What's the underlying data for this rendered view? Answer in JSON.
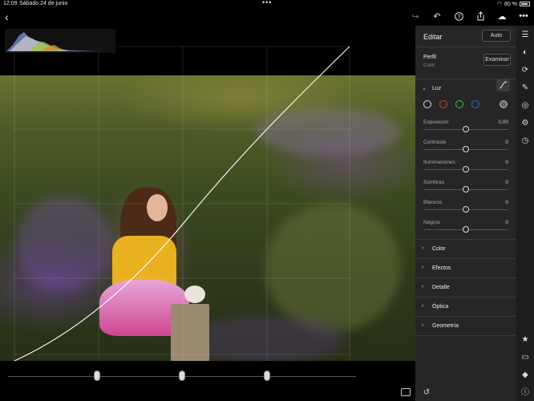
{
  "status": {
    "time": "12:09",
    "date": "Sábado 24 de junio",
    "battery": "80 %"
  },
  "toolbar": {
    "icons": [
      "share-back-icon",
      "undo-icon",
      "help-icon",
      "export-icon",
      "cloud-sync-icon",
      "more-icon"
    ]
  },
  "panel": {
    "title": "Editar",
    "auto_label": "Auto",
    "profile": {
      "label": "Perfil",
      "value": "Color",
      "browse_label": "Examinar"
    },
    "luz": {
      "label": "Luz",
      "channels": [
        {
          "name": "white-channel-icon",
          "color": "#dddddd"
        },
        {
          "name": "red-channel-icon",
          "color": "#e03a3a"
        },
        {
          "name": "green-channel-icon",
          "color": "#4cbf4c"
        },
        {
          "name": "blue-channel-icon",
          "color": "#3a62d6"
        }
      ],
      "sliders": [
        {
          "label": "Exposición",
          "value": "0,00"
        },
        {
          "label": "Contraste",
          "value": "0"
        },
        {
          "label": "Iluminaciones",
          "value": "0"
        },
        {
          "label": "Sombras",
          "value": "0"
        },
        {
          "label": "Blancos",
          "value": "0"
        },
        {
          "label": "Negros",
          "value": "0"
        }
      ]
    },
    "sections": [
      "Color",
      "Efectos",
      "Detalle",
      "Óptica",
      "Geometría"
    ]
  },
  "accent": "#ffffff"
}
